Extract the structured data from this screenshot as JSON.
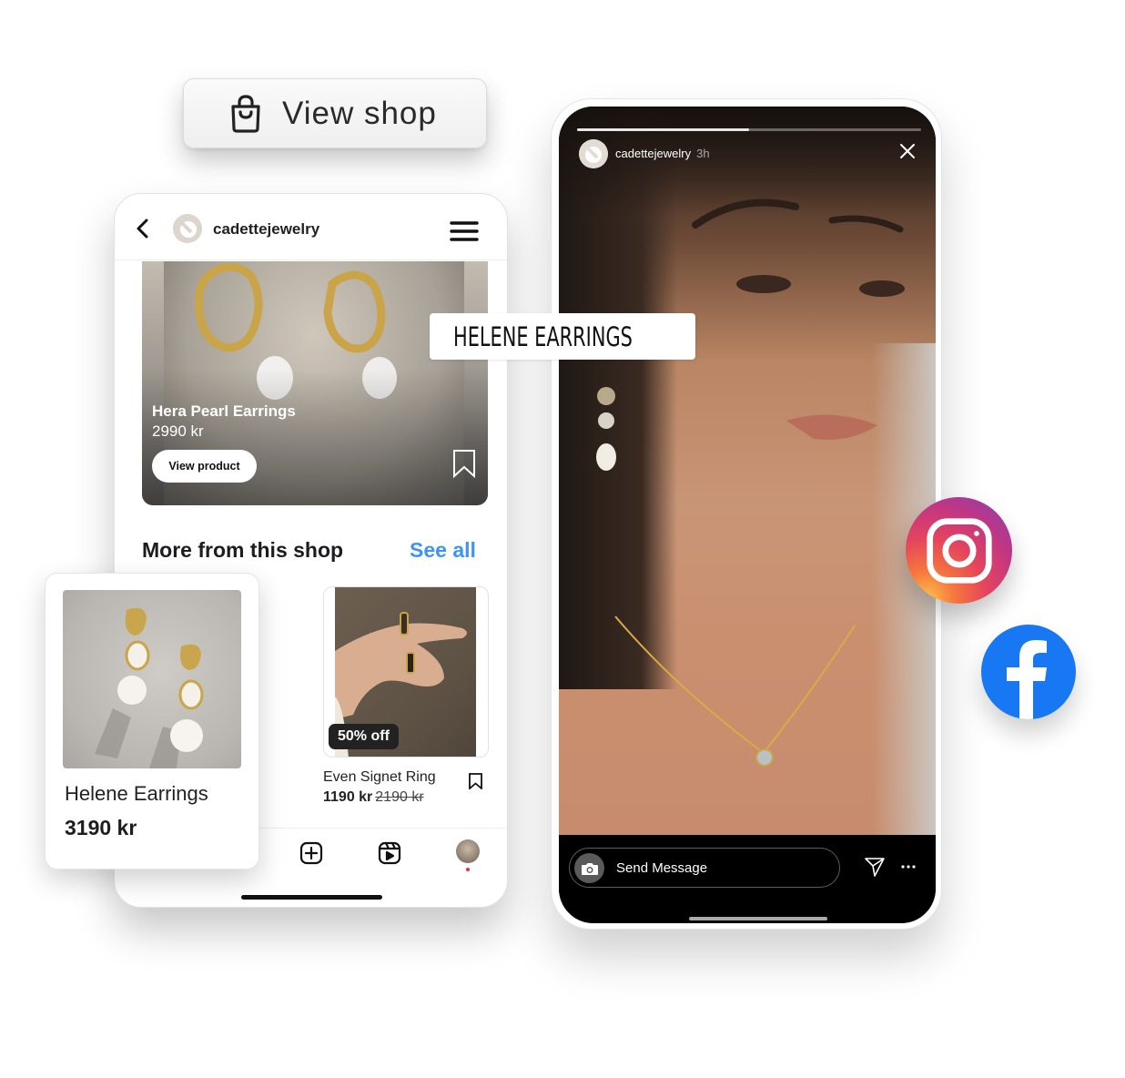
{
  "view_shop": {
    "label": "View shop",
    "icon": "shopping-bag-icon"
  },
  "shop_page": {
    "username": "cadettejewelry",
    "back_icon": "chevron-left-icon",
    "menu_icon": "hamburger-menu-icon",
    "featured": {
      "name": "Hera Pearl Earrings",
      "price": "2990 kr",
      "button": "View product",
      "bookmark_icon": "bookmark-icon"
    },
    "more_section": {
      "title": "More from this shop",
      "see_all": "See all"
    },
    "products": [
      {
        "name": "Helene Earrings",
        "price": "3190 kr"
      },
      {
        "name": "Even Signet Ring",
        "price": "1190 kr",
        "old_price": "2190 kr",
        "badge": "50% off"
      }
    ],
    "nav": [
      "plus-square-icon",
      "reels-icon",
      "profile-avatar"
    ]
  },
  "story": {
    "username": "cadettejewelry",
    "time": "3h",
    "progress": 0.5,
    "product_sticker": "HELENE EARRINGS",
    "message_placeholder": "Send Message",
    "close_icon": "close-icon",
    "camera_icon": "camera-icon",
    "send_icon": "send-icon",
    "more_icon": "more-horizontal-icon"
  },
  "social": {
    "instagram": "instagram-icon",
    "facebook": "facebook-icon"
  },
  "colors": {
    "link_blue": "#3e95ef",
    "facebook_blue": "#1877f2",
    "badge_dark": "#222222",
    "notification_red": "#ee2c3c"
  }
}
